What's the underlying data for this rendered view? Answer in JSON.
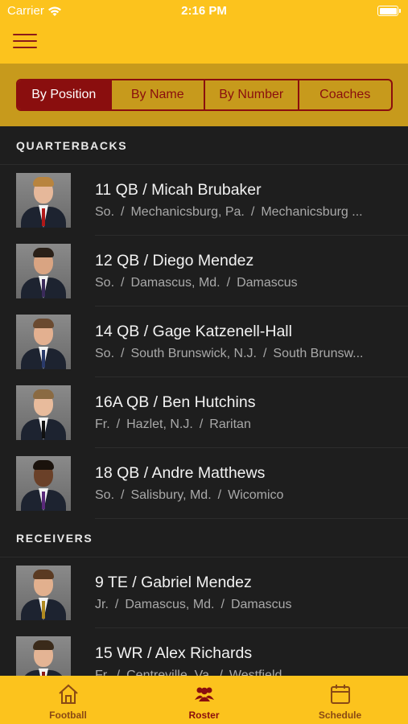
{
  "status_bar": {
    "carrier": "Carrier",
    "time": "2:16 PM"
  },
  "segments": [
    {
      "label": "By Position",
      "active": true
    },
    {
      "label": "By Name",
      "active": false
    },
    {
      "label": "By Number",
      "active": false
    },
    {
      "label": "Coaches",
      "active": false
    }
  ],
  "sections": [
    {
      "title": "QUARTERBACKS",
      "players": [
        {
          "title": "11 QB / Micah Brubaker",
          "year": "So.",
          "hometown": "Mechanicsburg, Pa.",
          "school": "Mechanicsburg ..."
        },
        {
          "title": "12 QB / Diego Mendez",
          "year": "So.",
          "hometown": "Damascus, Md.",
          "school": "Damascus"
        },
        {
          "title": "14 QB / Gage Katzenell-Hall",
          "year": "So.",
          "hometown": "South Brunswick, N.J.",
          "school": "South Brunsw..."
        },
        {
          "title": "16A QB / Ben Hutchins",
          "year": "Fr.",
          "hometown": "Hazlet, N.J.",
          "school": "Raritan"
        },
        {
          "title": "18 QB / Andre Matthews",
          "year": "So.",
          "hometown": "Salisbury, Md.",
          "school": "Wicomico"
        }
      ]
    },
    {
      "title": "RECEIVERS",
      "players": [
        {
          "title": "9 TE / Gabriel Mendez",
          "year": "Jr.",
          "hometown": "Damascus, Md.",
          "school": "Damascus"
        },
        {
          "title": "15 WR / Alex Richards",
          "year": "Fr.",
          "hometown": "Centreville, Va.",
          "school": "Westfield"
        }
      ]
    }
  ],
  "tabs": [
    {
      "label": "Football",
      "icon": "home-icon",
      "active": false
    },
    {
      "label": "Roster",
      "icon": "people-icon",
      "active": true
    },
    {
      "label": "Schedule",
      "icon": "calendar-icon",
      "active": false
    }
  ],
  "colors": {
    "brand_yellow": "#fcc31d",
    "brand_maroon": "#8a0e0e",
    "band_gold": "#c79a1c",
    "list_bg": "#1e1e1e"
  }
}
